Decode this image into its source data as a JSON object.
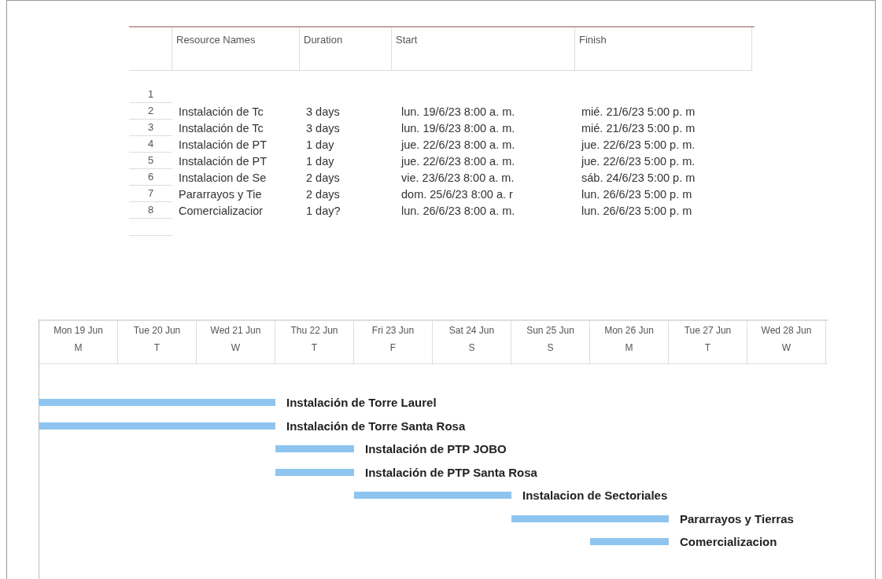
{
  "table": {
    "columns": [
      "Resource Names",
      "Duration",
      "Start",
      "Finish"
    ],
    "rows": [
      {
        "number": "1",
        "cells": [
          "",
          "",
          "",
          ""
        ]
      },
      {
        "number": "2",
        "cells": [
          "Instalación de Tc",
          "3 days",
          "lun. 19/6/23 8:00 a. m.",
          "mié. 21/6/23 5:00 p. m"
        ]
      },
      {
        "number": "3",
        "cells": [
          "Instalación de Tc",
          "3 days",
          "lun. 19/6/23 8:00 a. m.",
          "mié. 21/6/23 5:00 p. m"
        ]
      },
      {
        "number": "4",
        "cells": [
          "Instalación de PT",
          "1 day",
          "jue. 22/6/23 8:00 a. m.",
          "jue. 22/6/23 5:00 p. m."
        ]
      },
      {
        "number": "5",
        "cells": [
          "Instalación de PT",
          "1 day",
          "jue. 22/6/23 8:00 a. m.",
          "jue. 22/6/23 5:00 p. m."
        ]
      },
      {
        "number": "6",
        "cells": [
          "Instalacion de Se",
          "2 days",
          "vie. 23/6/23 8:00 a. m.",
          "sáb. 24/6/23 5:00 p. m"
        ]
      },
      {
        "number": "7",
        "cells": [
          "Pararrayos y Tie",
          "2 days",
          "dom. 25/6/23 8:00 a. r",
          "lun. 26/6/23 5:00 p. m"
        ]
      },
      {
        "number": "8",
        "cells": [
          "Comercializacior",
          "1 day?",
          "lun. 26/6/23 8:00 a. m.",
          "lun. 26/6/23 5:00 p. m"
        ]
      }
    ]
  },
  "gantt": {
    "days": [
      {
        "date": "Mon 19 Jun",
        "letter": "M"
      },
      {
        "date": "Tue 20 Jun",
        "letter": "T"
      },
      {
        "date": "Wed 21 Jun",
        "letter": "W"
      },
      {
        "date": "Thu 22 Jun",
        "letter": "T"
      },
      {
        "date": "Fri 23 Jun",
        "letter": "F"
      },
      {
        "date": "Sat 24 Jun",
        "letter": "S"
      },
      {
        "date": "Sun 25 Jun",
        "letter": "S"
      },
      {
        "date": "Mon 26 Jun",
        "letter": "M"
      },
      {
        "date": "Tue 27 Jun",
        "letter": "T"
      },
      {
        "date": "Wed 28 Jun",
        "letter": "W"
      }
    ],
    "tasks": [
      {
        "label": "Instalación de Torre Laurel"
      },
      {
        "label": "Instalación de Torre Santa Rosa"
      },
      {
        "label": "Instalación de PTP JOBO"
      },
      {
        "label": "Instalación de PTP Santa Rosa"
      },
      {
        "label": "Instalacion de Sectoriales"
      },
      {
        "label": "Pararrayos y Tierras"
      },
      {
        "label": "Comercializacion"
      }
    ]
  }
}
